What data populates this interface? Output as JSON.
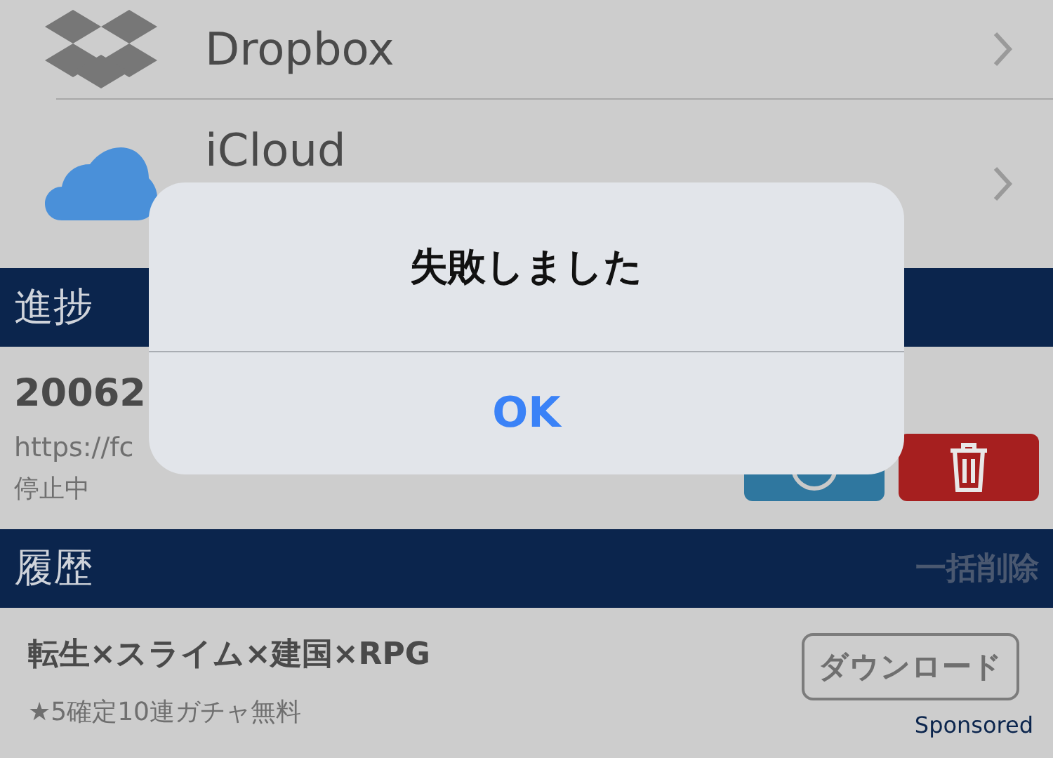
{
  "storage_list": [
    {
      "kind": "dropbox",
      "label": "Dropbox"
    },
    {
      "kind": "icloud",
      "label": "iCloud"
    }
  ],
  "progress": {
    "title": "進捗",
    "item": {
      "name": "20062",
      "url": "https://fc",
      "status": "停止中"
    }
  },
  "history": {
    "title": "履歴",
    "action": "一括削除",
    "ad": {
      "title": "転生×スライム×建国×RPG",
      "subtitle": "★5確定10連ガチャ無料",
      "button": "ダウンロード",
      "sponsor": "Sponsored"
    }
  },
  "alert": {
    "title": "失敗しました",
    "button": "OK"
  }
}
